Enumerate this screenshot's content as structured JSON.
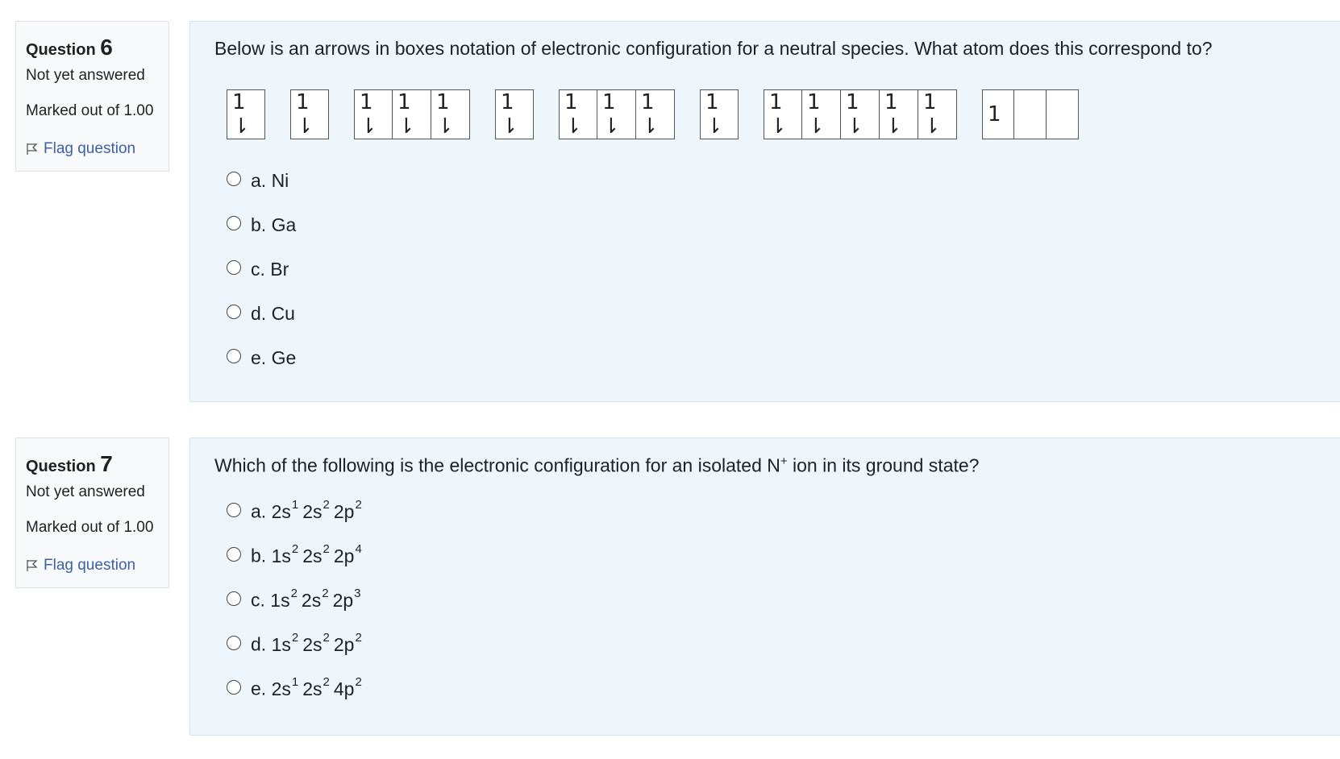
{
  "questions": [
    {
      "title_prefix": "Question",
      "number": "6",
      "state": "Not yet answered",
      "grade": "Marked out of 1.00",
      "flag_label": "Flag question",
      "text": "Below is an arrows in boxes notation of electronic configuration for a neutral species. What atom does this correspond to?",
      "orbital_groups": [
        [
          "1 ⇂"
        ],
        [
          "1 ⇂"
        ],
        [
          "1 ⇂",
          "1 ⇂",
          "1 ⇂"
        ],
        [
          "1 ⇂"
        ],
        [
          "1 ⇂",
          "1 ⇂",
          "1 ⇂"
        ],
        [
          "1 ⇂"
        ],
        [
          "1 ⇂",
          "1 ⇂",
          "1 ⇂",
          "1 ⇂",
          "1 ⇂"
        ],
        [
          "1",
          "",
          ""
        ]
      ],
      "options": [
        {
          "letter": "a.",
          "text": "Ni"
        },
        {
          "letter": "b.",
          "text": "Ga"
        },
        {
          "letter": "c.",
          "text": "Br"
        },
        {
          "letter": "d.",
          "text": "Cu"
        },
        {
          "letter": "e.",
          "text": "Ge"
        }
      ]
    },
    {
      "title_prefix": "Question",
      "number": "7",
      "state": "Not yet answered",
      "grade": "Marked out of 1.00",
      "flag_label": "Flag question",
      "text_before": "Which of the following is the electronic configuration for an isolated N",
      "text_sup": "+",
      "text_after": " ion in its ground state?",
      "options": [
        {
          "letter": "a.",
          "terms": [
            [
              "2s",
              "1"
            ],
            [
              "2s",
              "2"
            ],
            [
              "2p",
              "2"
            ]
          ]
        },
        {
          "letter": "b.",
          "terms": [
            [
              "1s",
              "2"
            ],
            [
              "2s",
              "2"
            ],
            [
              "2p",
              "4"
            ]
          ]
        },
        {
          "letter": "c.",
          "terms": [
            [
              "1s",
              "2"
            ],
            [
              "2s",
              "2"
            ],
            [
              "2p",
              "3"
            ]
          ]
        },
        {
          "letter": "d.",
          "terms": [
            [
              "1s",
              "2"
            ],
            [
              "2s",
              "2"
            ],
            [
              "2p",
              "2"
            ]
          ]
        },
        {
          "letter": "e.",
          "terms": [
            [
              "2s",
              "1"
            ],
            [
              "2s",
              "2"
            ],
            [
              "4p",
              "2"
            ]
          ]
        }
      ]
    }
  ]
}
